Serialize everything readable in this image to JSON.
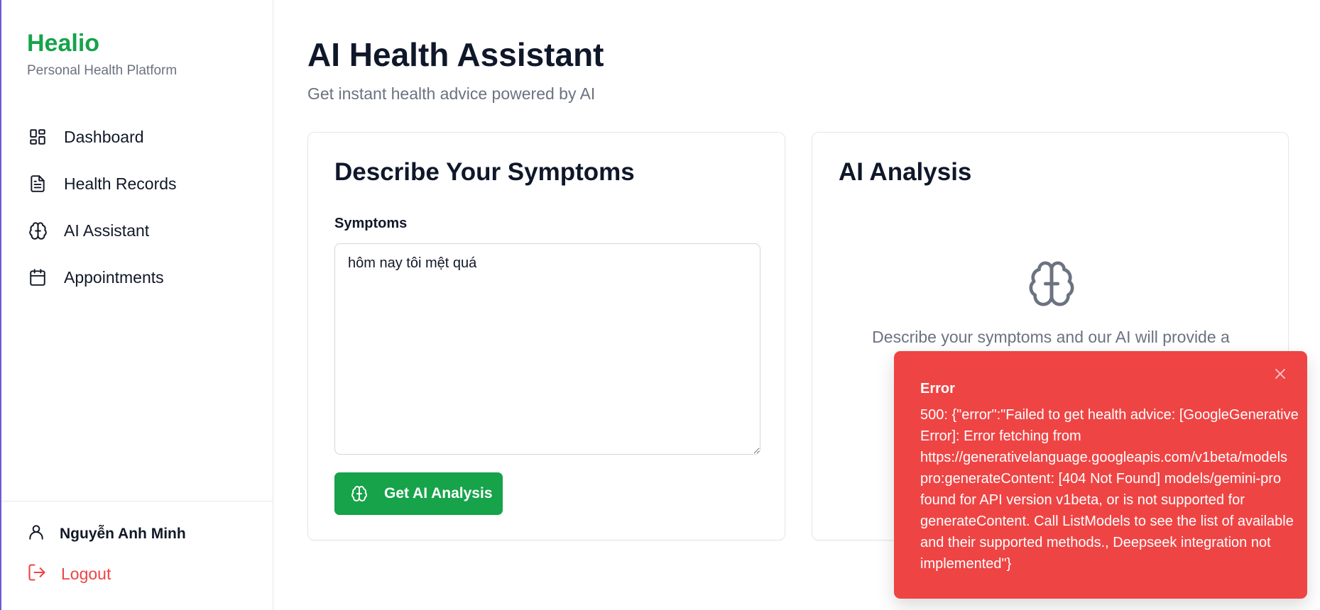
{
  "brand": {
    "name": "Healio",
    "tagline": "Personal Health Platform"
  },
  "sidebar": {
    "items": [
      {
        "label": "Dashboard",
        "icon": "dashboard-grid-icon"
      },
      {
        "label": "Health Records",
        "icon": "document-icon"
      },
      {
        "label": "AI Assistant",
        "icon": "brain-icon"
      },
      {
        "label": "Appointments",
        "icon": "calendar-icon"
      }
    ],
    "user": {
      "name": "Nguyễn Anh Minh",
      "icon": "user-icon"
    },
    "logout": {
      "label": "Logout",
      "icon": "logout-icon"
    }
  },
  "page": {
    "title": "AI Health Assistant",
    "subtitle": "Get instant health advice powered by AI"
  },
  "symptoms_card": {
    "title": "Describe Your Symptoms",
    "field_label": "Symptoms",
    "input_value": "hôm nay tôi mệt quá",
    "button_label": "Get AI Analysis"
  },
  "analysis_card": {
    "title": "AI Analysis",
    "empty_text": "Describe your symptoms and our AI will provide a"
  },
  "toast": {
    "title": "Error",
    "message": "500: {\"error\":\"Failed to get health advice: [GoogleGenerative\nError]: Error fetching from\nhttps://generativelanguage.googleapis.com/v1beta/models\npro:generateContent: [404 Not Found] models/gemini-pro\nfound for API version v1beta, or is not supported for\ngenerateContent. Call ListModels to see the list of available\nand their supported methods., Deepseek integration not\nimplemented\"}"
  },
  "colors": {
    "brand_green": "#16a34a",
    "danger_red": "#ef4444",
    "muted_text": "#6b7280"
  }
}
